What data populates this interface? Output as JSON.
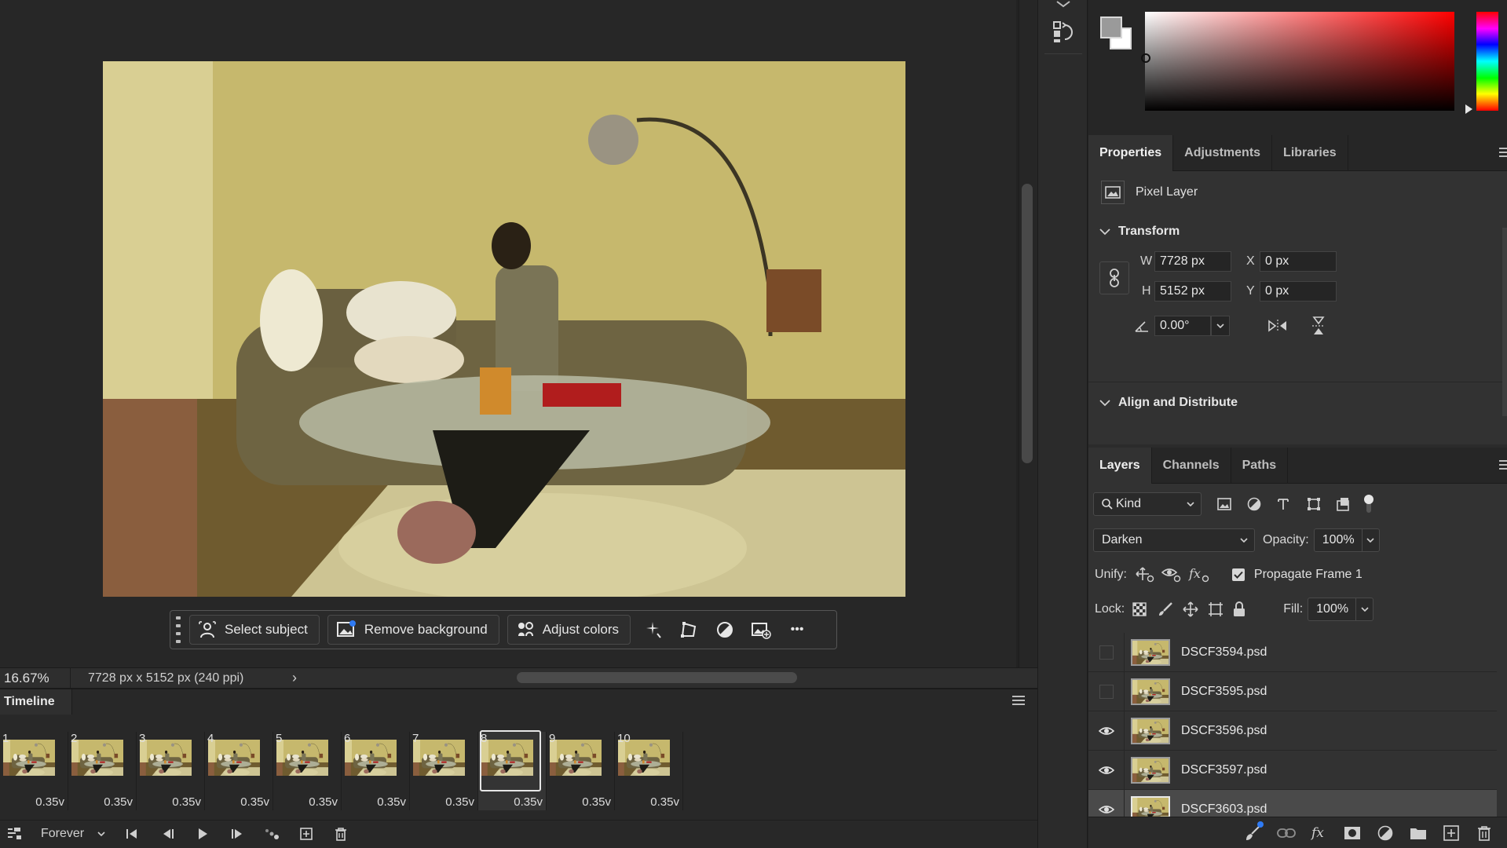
{
  "canvas": {
    "zoom": "16.67%",
    "doc_size": "7728 px x 5152 px (240 ppi)",
    "status_chevron": "›"
  },
  "taskbar": {
    "select_subject": "Select subject",
    "remove_background": "Remove background",
    "adjust_colors": "Adjust colors",
    "more": "•••"
  },
  "timeline": {
    "tab": "Timeline",
    "frames": [
      {
        "num": "1",
        "delay": "0.35"
      },
      {
        "num": "2",
        "delay": "0.35"
      },
      {
        "num": "3",
        "delay": "0.35"
      },
      {
        "num": "4",
        "delay": "0.35"
      },
      {
        "num": "5",
        "delay": "0.35"
      },
      {
        "num": "6",
        "delay": "0.35"
      },
      {
        "num": "7",
        "delay": "0.35"
      },
      {
        "num": "8",
        "delay": "0.35"
      },
      {
        "num": "9",
        "delay": "0.35"
      },
      {
        "num": "10",
        "delay": "0.35"
      }
    ],
    "selected_frame": "8",
    "delay_caret": "v",
    "loop": "Forever"
  },
  "properties_tabs": [
    "Properties",
    "Adjustments",
    "Libraries"
  ],
  "properties": {
    "layer_type": "Pixel Layer",
    "transform_title": "Transform",
    "w_label": "W",
    "w_value": "7728 px",
    "h_label": "H",
    "h_value": "5152 px",
    "x_label": "X",
    "x_value": "0 px",
    "y_label": "Y",
    "y_value": "0 px",
    "angle_value": "0.00°",
    "align_title": "Align and Distribute"
  },
  "layers_tabs": [
    "Layers",
    "Channels",
    "Paths"
  ],
  "layers": {
    "filter_kind": "Kind",
    "blend_mode": "Darken",
    "opacity_label": "Opacity:",
    "opacity_value": "100%",
    "unify_label": "Unify:",
    "propagate_label": "Propagate Frame 1",
    "lock_label": "Lock:",
    "fill_label": "Fill:",
    "fill_value": "100%",
    "items": [
      {
        "name": "DSCF3594.psd",
        "visible": false,
        "selected": false
      },
      {
        "name": "DSCF3595.psd",
        "visible": false,
        "selected": false
      },
      {
        "name": "DSCF3596.psd",
        "visible": true,
        "selected": false
      },
      {
        "name": "DSCF3597.psd",
        "visible": true,
        "selected": false
      },
      {
        "name": "DSCF3603.psd",
        "visible": true,
        "selected": true
      }
    ]
  },
  "colors": {
    "accent_blue": "#2f7bf5",
    "panel_bg": "#323232",
    "foreground": "#9a9a9a",
    "background": "#ffffff"
  }
}
